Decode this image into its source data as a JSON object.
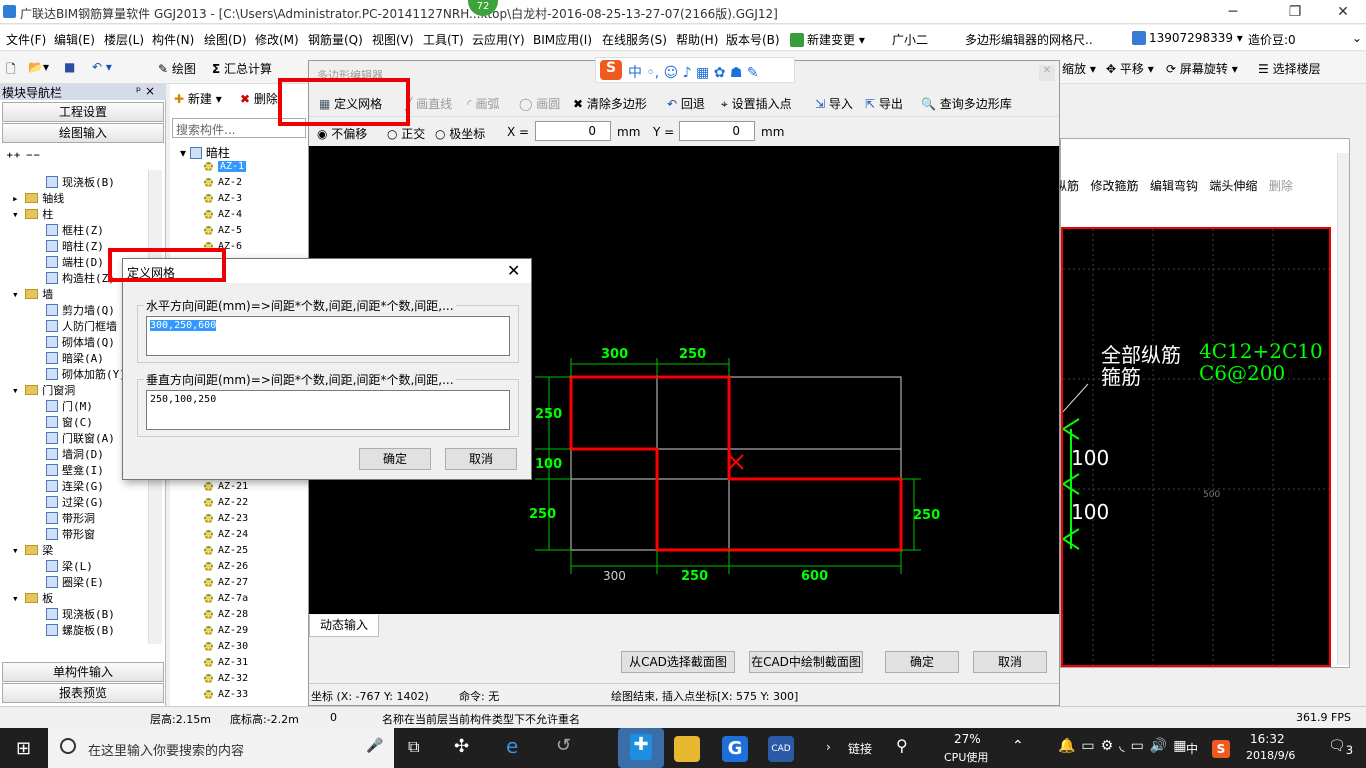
{
  "app": {
    "title": "广联达BIM钢筋算量软件 GGJ2013 - [C:\\Users\\Administrator.PC-20141127NRH...ktop\\白龙村-2016-08-25-13-27-07(2166版).GGJ12]",
    "badge": "72"
  },
  "menu": [
    "文件(F)",
    "编辑(E)",
    "楼层(L)",
    "构件(N)",
    "绘图(D)",
    "修改(M)",
    "钢筋量(Q)",
    "视图(V)",
    "工具(T)",
    "云应用(Y)",
    "BIM应用(I)",
    "在线服务(S)",
    "帮助(H)",
    "版本号(B)",
    "新建变更 ▾",
    "广小二",
    "多边形编辑器的网格尺..",
    "13907298339 ▾",
    "造价豆:0"
  ],
  "toolbar": {
    "draw": "绘图",
    "sum": "汇总计算",
    "zoom": "缩放 ▾",
    "pan": "平移 ▾",
    "rotate": "屏幕旋转 ▾",
    "floor": "选择楼层"
  },
  "left": {
    "header": "模块导航栏",
    "pin": "ᵖ ×",
    "btn1": "工程设置",
    "btn2": "绘图输入",
    "btn3": "单构件输入",
    "btn4": "报表预览",
    "tree": [
      "现浇板(B)",
      "轴线",
      "柱",
      "框柱(Z)",
      "暗柱(Z)",
      "端柱(D)",
      "构造柱(Z)",
      "墙",
      "剪力墙(Q)",
      "人防门框墙",
      "砌体墙(Q)",
      "暗梁(A)",
      "砌体加筋(Y)",
      "门窗洞",
      "门(M)",
      "窗(C)",
      "门联窗(A)",
      "墙洞(D)",
      "壁龛(I)",
      "连梁(G)",
      "过梁(G)",
      "带形洞",
      "带形窗",
      "梁",
      "梁(L)",
      "圈梁(E)",
      "板",
      "现浇板(B)",
      "螺旋板(B)"
    ]
  },
  "mid": {
    "new": "新建 ▾",
    "delete": "删除",
    "search": "搜索构件...",
    "root": "暗柱",
    "items": [
      "AZ-1",
      "AZ-2",
      "AZ-3",
      "AZ-4",
      "AZ-5",
      "AZ-6",
      "AZ-21",
      "AZ-22",
      "AZ-23",
      "AZ-24",
      "AZ-25",
      "AZ-26",
      "AZ-27",
      "AZ-7a",
      "AZ-28",
      "AZ-29",
      "AZ-30",
      "AZ-31",
      "AZ-32",
      "AZ-33"
    ]
  },
  "editor": {
    "title": "多边形编辑器",
    "tb": [
      "定义网格",
      "画直线",
      "画弧",
      "画圆",
      "清除多边形",
      "回退",
      "设置插入点",
      "导入",
      "导出",
      "查询多边形库"
    ],
    "snap": [
      "不偏移",
      "正交",
      "极坐标"
    ],
    "x_label": "X =",
    "x_val": "0",
    "y_label": "Y =",
    "y_val": "0",
    "unit": "mm",
    "tab": "动态输入",
    "btn_cad_select": "从CAD选择截面图",
    "btn_cad_draw": "在CAD中绘制截面图",
    "ok": "确定",
    "cancel": "取消",
    "status_coord": "坐标 (X: -767 Y: 1402)",
    "status_cmd": "命令: 无",
    "status_msg": "绘图结束, 插入点坐标[X: 575 Y: 300]"
  },
  "canvas_dims": {
    "top1": "300",
    "top2": "250",
    "left1": "250",
    "left2": "100",
    "left3": "250",
    "right": "250",
    "bot1": "300",
    "bot2": "250",
    "bot3": "600"
  },
  "right": {
    "tb": [
      "纵筋",
      "修改箍筋",
      "编辑弯钩",
      "端头伸缩",
      "删除"
    ],
    "label1": "全部纵筋",
    "val1": "4C12+2C10",
    "label2": "箍筋",
    "val2": "C6@200",
    "dim1": "100",
    "dim2": "100",
    "dim3": "500"
  },
  "dialog": {
    "title": "定义网格",
    "h_label": "水平方向间距(mm)=>间距*个数,间距,间距*个数,间距,...",
    "h_value": "300,250,600",
    "v_label": "垂直方向间距(mm)=>间距*个数,间距,间距*个数,间距,...",
    "v_value": "250,100,250",
    "ok": "确定",
    "cancel": "取消"
  },
  "status": {
    "floor_h": "层高:2.15m",
    "bottom_h": "底标高:-2.2m",
    "zero": "0",
    "msg": "名称在当前层当前构件类型下不允许重名",
    "fps": "361.9 FPS"
  },
  "taskbar": {
    "search": "在这里输入你要搜索的内容",
    "link": "链接",
    "cpu_pct": "27%",
    "cpu_label": "CPU使用",
    "ime": "中",
    "time": "16:32",
    "date": "2018/9/6",
    "notif": "3"
  },
  "colors": {
    "red": "#e00000",
    "green": "#00ff00",
    "canvas": "#000000"
  }
}
